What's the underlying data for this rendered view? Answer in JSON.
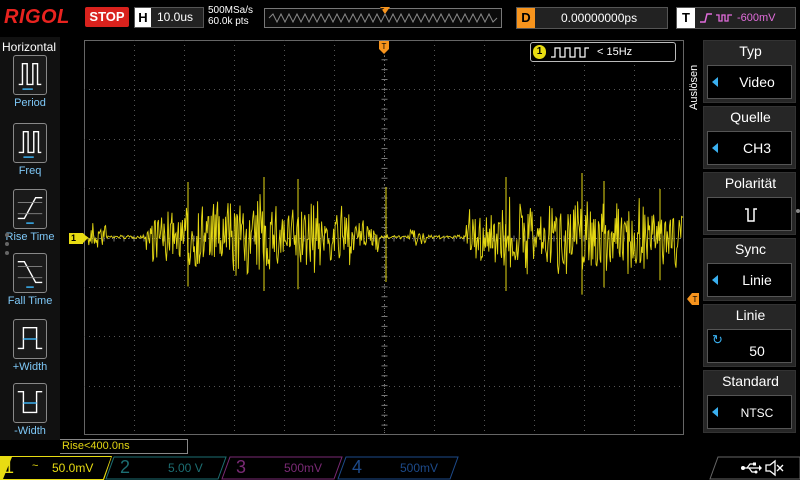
{
  "topbar": {
    "logo": "RIGOL",
    "run_state": "STOP",
    "timebase_label": "H",
    "timebase_value": "10.0us",
    "sample_rate": "500MSa/s",
    "memory_depth": "60.0k pts",
    "memory_marker": "T",
    "delay_label": "D",
    "delay_value": "0.00000000ps",
    "trigger_label": "T",
    "trigger_level": "-600mV"
  },
  "left_menu": {
    "title": "Horizontal",
    "items": [
      {
        "label": "Period",
        "icon": "period-icon"
      },
      {
        "label": "Freq",
        "icon": "frequency-icon"
      },
      {
        "label": "Rise Time",
        "icon": "rise-time-icon"
      },
      {
        "label": "Fall Time",
        "icon": "fall-time-icon"
      },
      {
        "label": "+Width",
        "icon": "positive-width-icon"
      },
      {
        "label": "-Width",
        "icon": "negative-width-icon"
      }
    ]
  },
  "scope": {
    "channel_marker": "1",
    "trigger_marker_top": "T",
    "trigger_marker_right": "T",
    "freq_counter": {
      "channel": "1",
      "value": "< 15Hz"
    },
    "measurement": "Rise<400.0ns"
  },
  "right_menu": {
    "side_title": "Auslösen",
    "items": [
      {
        "title": "Typ",
        "value": "Video"
      },
      {
        "title": "Quelle",
        "value": "CH3"
      },
      {
        "title": "Polarität",
        "value": "∨"
      },
      {
        "title": "Sync",
        "value": "Linie"
      },
      {
        "title": "Linie",
        "value": "50"
      },
      {
        "title": "Standard",
        "value": "NTSC"
      }
    ]
  },
  "bottombar": {
    "channels": [
      {
        "num": "1",
        "coupling": "~",
        "scale": "50.0mV",
        "color": "#e8dc12",
        "active": true
      },
      {
        "num": "2",
        "coupling": "",
        "scale": "5.00 V",
        "color": "#1c6e72",
        "active": false
      },
      {
        "num": "3",
        "coupling": "",
        "scale": "500mV",
        "color": "#7a2a75",
        "active": false
      },
      {
        "num": "4",
        "coupling": "",
        "scale": "500mV",
        "color": "#1d4a8a",
        "active": false
      }
    ]
  },
  "colors": {
    "ch1": "#e4d713",
    "trigger": "#f7941d",
    "menu_accent": "#3ab0f0",
    "run_state": "#d9221d"
  }
}
